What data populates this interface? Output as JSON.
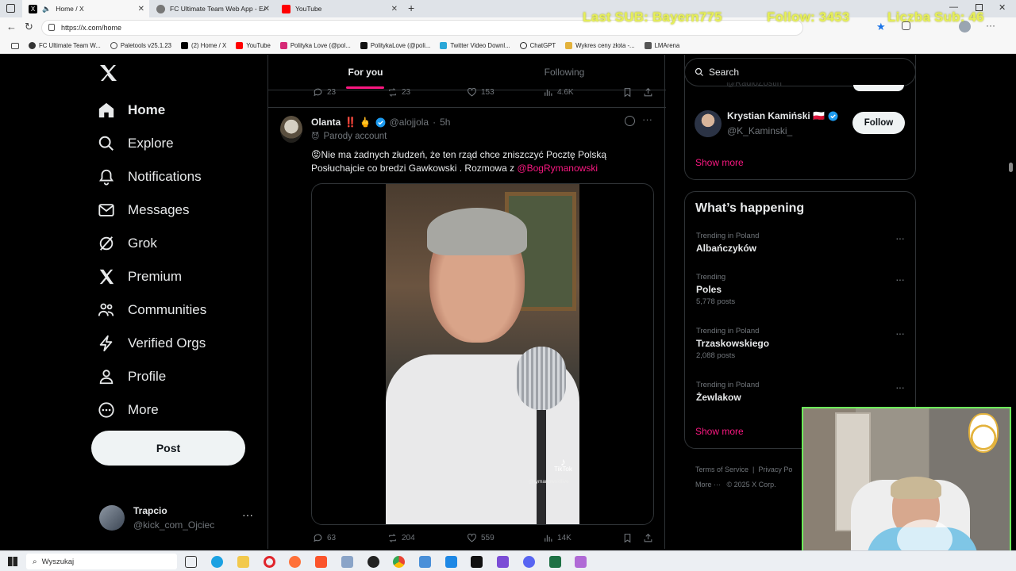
{
  "browser": {
    "tabs": [
      {
        "label": "Home / X",
        "active": true
      },
      {
        "label": "FC Ultimate Team Web App - EA S",
        "active": false
      },
      {
        "label": "YouTube",
        "active": false
      }
    ],
    "url": "https://x.com/home",
    "bookmarks": [
      "FC Ultimate Team W...",
      "Paletools v25.1.23",
      "(2) Home / X",
      "YouTube",
      "Polityka Love (@pol...",
      "PolitykaLove (@poli...",
      "Twitter Video Downl...",
      "ChatGPT",
      "Wykres ceny złota -...",
      "LMArena"
    ]
  },
  "stream_overlay": {
    "last_sub": "Last SUB: Bayern775",
    "follow": "Follow: 3453",
    "sub_count": "Liczba Sub: 46"
  },
  "nav": {
    "items": [
      {
        "label": "Home",
        "icon": "home-icon"
      },
      {
        "label": "Explore",
        "icon": "search-icon"
      },
      {
        "label": "Notifications",
        "icon": "bell-icon"
      },
      {
        "label": "Messages",
        "icon": "envelope-icon"
      },
      {
        "label": "Grok",
        "icon": "grok-icon"
      },
      {
        "label": "Premium",
        "icon": "x-logo-icon"
      },
      {
        "label": "Communities",
        "icon": "people-icon"
      },
      {
        "label": "Verified Orgs",
        "icon": "lightning-icon"
      },
      {
        "label": "Profile",
        "icon": "person-icon"
      },
      {
        "label": "More",
        "icon": "more-circle-icon"
      }
    ],
    "post_label": "Post",
    "account": {
      "name": "Trapcio",
      "handle": "@kick_com_Ojciec"
    }
  },
  "feed": {
    "tabs": [
      "For you",
      "Following"
    ],
    "prev_post_stats": {
      "replies": "23",
      "reposts": "23",
      "likes": "153",
      "views": "4.6K"
    },
    "post": {
      "author": "Olanta",
      "author_emoji": "‼️ 🖕",
      "handle": "@alojjola",
      "time": "5h",
      "parody_label": "Parody account",
      "text_line1": "😡Nie ma żadnych złudzeń, że ten rząd chce zniszczyć Pocztę Polską",
      "text_line2": "Posłuchajcie co bredzi Gawkowski . Rozmowa z ",
      "mention": "@BogRymanowski",
      "video_watermark": "TikTok",
      "video_watermark_handle": "@rymanowskilive",
      "stats": {
        "replies": "63",
        "reposts": "204",
        "likes": "559",
        "views": "14K"
      }
    }
  },
  "right": {
    "search_placeholder": "Search",
    "suggestion_partial_handle": "@RadioZostin",
    "suggestion": {
      "name": "Krystian Kamiński 🇵🇱",
      "handle": "@K_Kaminski_",
      "button": "Follow"
    },
    "show_more": "Show more",
    "whats_happening": "What’s happening",
    "trends": [
      {
        "meta": "Trending in Poland",
        "name": "Albańczyków",
        "count": ""
      },
      {
        "meta": "Trending",
        "name": "Poles",
        "count": "5,778 posts"
      },
      {
        "meta": "Trending in Poland",
        "name": "Trzaskowskiego",
        "count": "2,088 posts"
      },
      {
        "meta": "Trending in Poland",
        "name": "Żewlakow",
        "count": ""
      }
    ],
    "show_more_2": "Show more",
    "footer": {
      "terms": "Terms of Service",
      "privacy": "Privacy Po",
      "more": "More ···",
      "copyright": "© 2025 X Corp."
    }
  },
  "taskbar": {
    "search_placeholder": "Wyszukaj"
  },
  "colors": {
    "accent_blue": "#1d9bf0",
    "pink": "#f91880",
    "overlay_yellow": "#e6ef58",
    "webcam_border": "#6dff5a"
  }
}
